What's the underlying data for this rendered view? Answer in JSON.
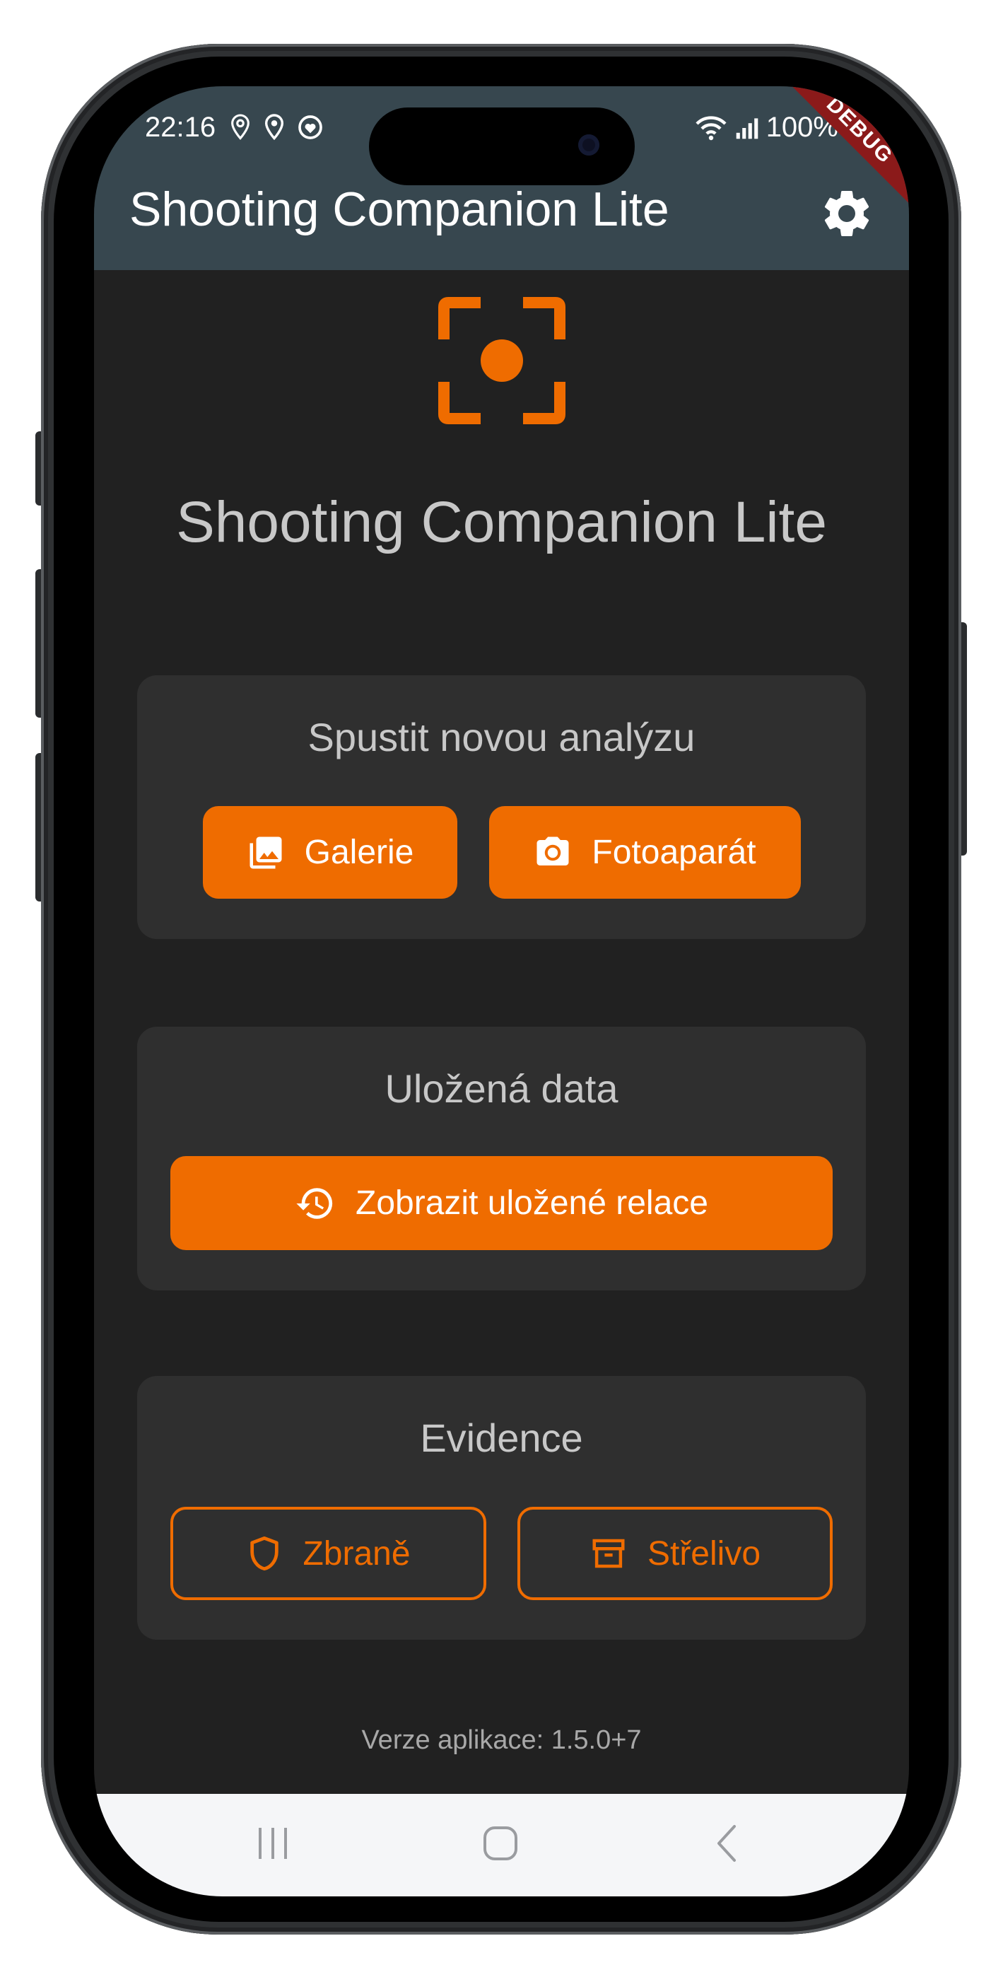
{
  "status_bar": {
    "time": "22:16",
    "battery": "100%",
    "left_icons": [
      "location-icon",
      "location-icon",
      "heart-sync-icon"
    ],
    "right_icons": [
      "wifi-icon",
      "signal-icon"
    ]
  },
  "app_bar": {
    "title": "Shooting Companion Lite",
    "action_icon": "gear-icon",
    "debug_banner": "DEBUG",
    "color": "#37474f"
  },
  "hero": {
    "logo_icon": "target-frame-icon",
    "title": "Shooting Companion Lite",
    "accent": "#ef6c00"
  },
  "cards": {
    "new_analysis": {
      "title": "Spustit novou analýzu",
      "gallery_label": "Galerie",
      "gallery_icon": "gallery-icon",
      "camera_label": "Fotoaparát",
      "camera_icon": "camera-icon"
    },
    "saved_data": {
      "title": "Uložená data",
      "sessions_label": "Zobrazit uložené relace",
      "sessions_icon": "history-icon"
    },
    "records": {
      "title": "Evidence",
      "weapons_label": "Zbraně",
      "weapons_icon": "shield-icon",
      "ammo_label": "Střelivo",
      "ammo_icon": "archive-box-icon"
    }
  },
  "footer": {
    "version": "Verze aplikace: 1.5.0+7"
  },
  "nav_bar": {
    "items": [
      "recent-apps-icon",
      "home-icon",
      "back-icon"
    ]
  }
}
